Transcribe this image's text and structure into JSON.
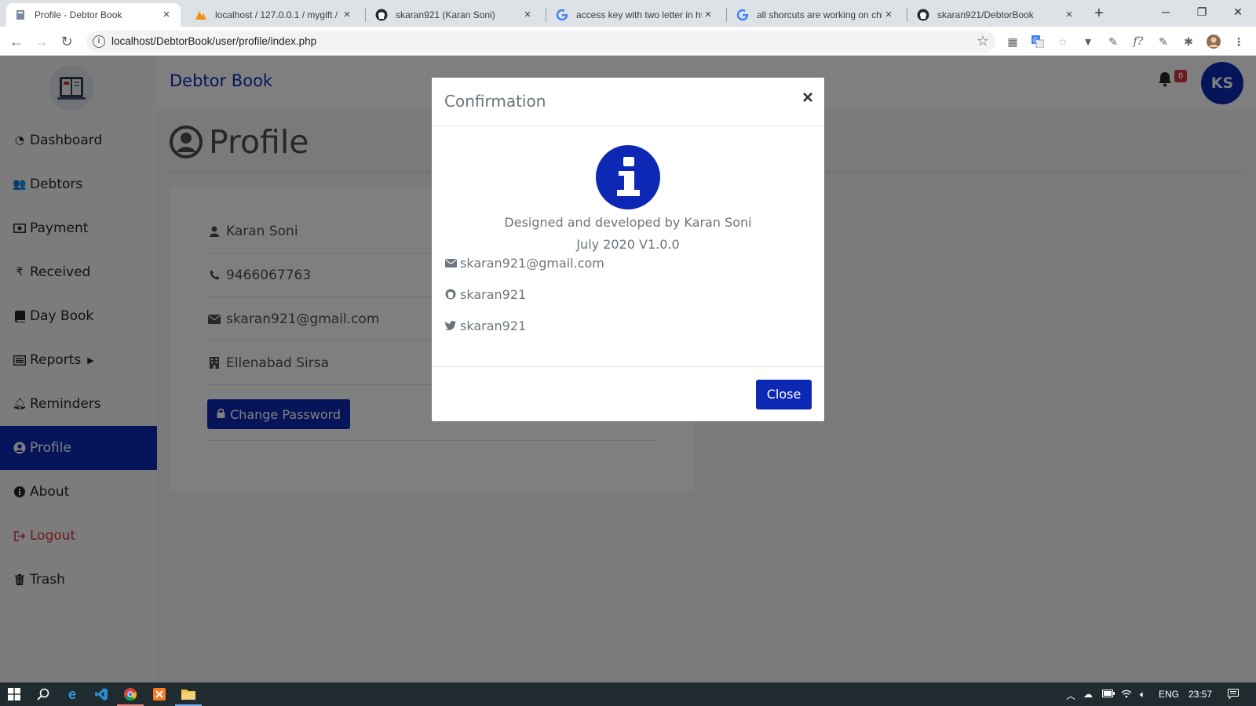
{
  "browser": {
    "tabs": [
      {
        "title": "Profile - Debtor Book",
        "icon": "book-favicon",
        "active": true
      },
      {
        "title": "localhost / 127.0.0.1 / mygift / ",
        "icon": "phpmyadmin-favicon",
        "active": false
      },
      {
        "title": "skaran921 (Karan Soni)",
        "icon": "github-favicon",
        "active": false
      },
      {
        "title": "access key with two letter in ht",
        "icon": "google-favicon",
        "active": false
      },
      {
        "title": "all shorcuts are working on chr",
        "icon": "google-favicon",
        "active": false
      },
      {
        "title": "skaran921/DebtorBook",
        "icon": "github-favicon",
        "active": false
      }
    ],
    "url": "localhost/DebtorBook/user/profile/index.php"
  },
  "app": {
    "brand": "Debtor Book",
    "notification_count": "0",
    "avatar_initials": "KS",
    "accent": "#0d28b5",
    "danger": "#dc3545"
  },
  "sidebar": {
    "items": [
      {
        "label": "Dashboard",
        "icon": "dashboard-icon"
      },
      {
        "label": "Debtors",
        "icon": "users-icon"
      },
      {
        "label": "Payment",
        "icon": "money-icon"
      },
      {
        "label": "Received",
        "icon": "rupee-icon"
      },
      {
        "label": "Day Book",
        "icon": "book-icon"
      },
      {
        "label": "Reports",
        "icon": "list-icon"
      },
      {
        "label": "Reminders",
        "icon": "bell-icon"
      },
      {
        "label": "Profile",
        "icon": "user-circle-icon"
      },
      {
        "label": "About",
        "icon": "info-circle-icon"
      },
      {
        "label": "Logout",
        "icon": "sign-out-icon"
      },
      {
        "label": "Trash",
        "icon": "trash-icon"
      }
    ]
  },
  "page": {
    "title": "Profile",
    "profile": {
      "name": "Karan Soni",
      "phone": "9466067763",
      "email": "skaran921@gmail.com",
      "address": "Ellenabad Sirsa"
    },
    "change_password_label": "Change Password"
  },
  "modal": {
    "title": "Confirmation",
    "close_x": "×",
    "developer_line": "Designed and developed by Karan Soni",
    "version_line": "July 2020 V1.0.0",
    "contacts": {
      "email": "skaran921@gmail.com",
      "github": "skaran921",
      "twitter": "skaran921"
    },
    "close_button": "Close"
  },
  "taskbar": {
    "language": "ENG",
    "time": "23:57"
  }
}
